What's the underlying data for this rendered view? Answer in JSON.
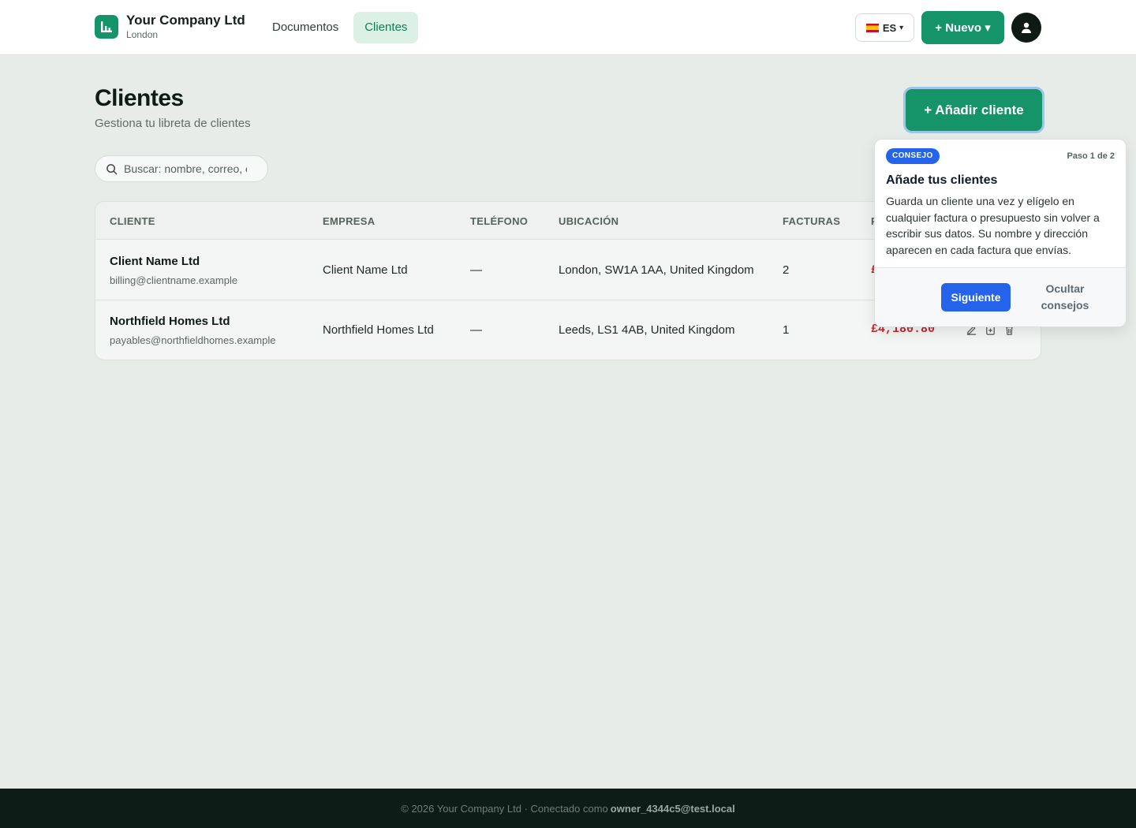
{
  "header": {
    "company_name": "Your Company Ltd",
    "company_city": "London",
    "nav": [
      {
        "label": "Documentos",
        "active": false
      },
      {
        "label": "Clientes",
        "active": true
      }
    ],
    "language": "ES",
    "new_button": "+ Nuevo ▾"
  },
  "page": {
    "title": "Clientes",
    "subtitle": "Gestiona tu libreta de clientes",
    "add_button": "+ Añadir cliente",
    "search_placeholder": "Buscar: nombre, correo, empresa"
  },
  "table": {
    "columns": [
      "CLIENTE",
      "EMPRESA",
      "TELÉFONO",
      "UBICACIÓN",
      "FACTURAS",
      "P"
    ],
    "rows": [
      {
        "name": "Client Name Ltd",
        "email": "billing@clientname.example",
        "company": "Client Name Ltd",
        "phone": "—",
        "location": "London, SW1A 1AA, United Kingdom",
        "invoices": "2",
        "amount": "£"
      },
      {
        "name": "Northfield Homes Ltd",
        "email": "payables@northfieldhomes.example",
        "company": "Northfield Homes Ltd",
        "phone": "—",
        "location": "Leeds, LS1 4AB, United Kingdom",
        "invoices": "1",
        "amount": "£4,180.80"
      }
    ],
    "row_actions": [
      "edit-icon",
      "duplicate-icon",
      "trash-icon"
    ]
  },
  "tip": {
    "badge": "CONSEJO",
    "step": "Paso 1 de 2",
    "title": "Añade tus clientes",
    "body": "Guarda un cliente una vez y elígelo en cualquier factura o presupuesto sin volver a escribir sus datos. Su nombre y dirección aparecen en cada factura que envías.",
    "next": "Siguiente",
    "hide": "Ocultar consejos"
  },
  "footer": {
    "text": "© 2026 Your Company Ltd · Conectado como",
    "user": "owner_4344c5@test.local"
  },
  "colors": {
    "brand": "#15946a",
    "tip_accent": "#2563eb",
    "amount_red": "#c9262d"
  }
}
